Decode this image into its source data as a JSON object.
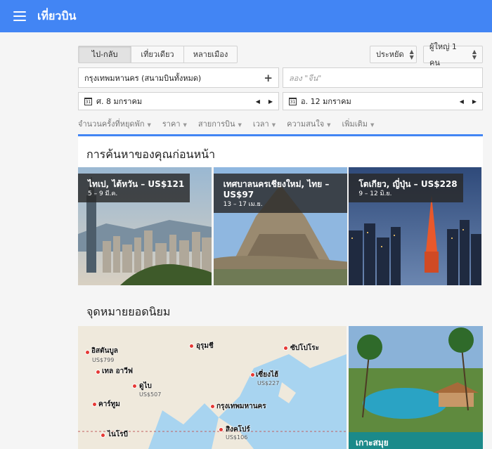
{
  "app": {
    "title": "เที่ยวบิน"
  },
  "trip_type": {
    "options": [
      "ไป-กลับ",
      "เที่ยวเดียว",
      "หลายเมือง"
    ],
    "selected": "ไป-กลับ"
  },
  "cabin": {
    "value": "ประหยัด"
  },
  "passengers": {
    "value": "ผู้ใหญ่ 1 คน"
  },
  "origin": {
    "value": "กรุงเทพมหานคร (สนามบินทั้งหมด)",
    "add_label": "+"
  },
  "destination": {
    "placeholder": "ลอง \"จีน\""
  },
  "depart_date": {
    "value": "ศ. 8 มกราคม",
    "cal": "31"
  },
  "return_date": {
    "value": "อ. 12 มกราคม",
    "cal": "31"
  },
  "filters": [
    "จำนวนครั้งที่หยุดพัก",
    "ราคา",
    "สายการบิน",
    "เวลา",
    "ความสนใจ",
    "เพิ่มเติม"
  ],
  "previous_searches": {
    "title": "การค้นหาของคุณก่อนหน้า",
    "cards": [
      {
        "dest": "ไทเป, ไต้หวัน – US$121",
        "dates": "5 – 9 มี.ค."
      },
      {
        "dest": "เทศบาลนครเชียงใหม่, ไทย – US$97",
        "dates": "13 – 17 เม.ย."
      },
      {
        "dest": "โตเกียว, ญี่ปุ่น – US$228",
        "dates": "9 – 12 มิ.ย."
      }
    ]
  },
  "popular": {
    "title": "จุดหมายยอดนิยม",
    "map_labels": [
      {
        "name": "อิสตันบูล",
        "price": "US$799"
      },
      {
        "name": "เทล อาวีฟ",
        "price": ""
      },
      {
        "name": "ดูไบ",
        "price": "US$507"
      },
      {
        "name": "คาร์ทูม",
        "price": ""
      },
      {
        "name": "ไนโรบี",
        "price": ""
      },
      {
        "name": "อุรุมชี",
        "price": ""
      },
      {
        "name": "ซัปโปโระ",
        "price": ""
      },
      {
        "name": "เซี่ยงไฮ้",
        "price": "US$227"
      },
      {
        "name": "กรุงเทพมหานคร",
        "price": ""
      },
      {
        "name": "สิงคโปร์",
        "price": "US$106"
      }
    ],
    "resort_label": "เกาะสมุย"
  }
}
